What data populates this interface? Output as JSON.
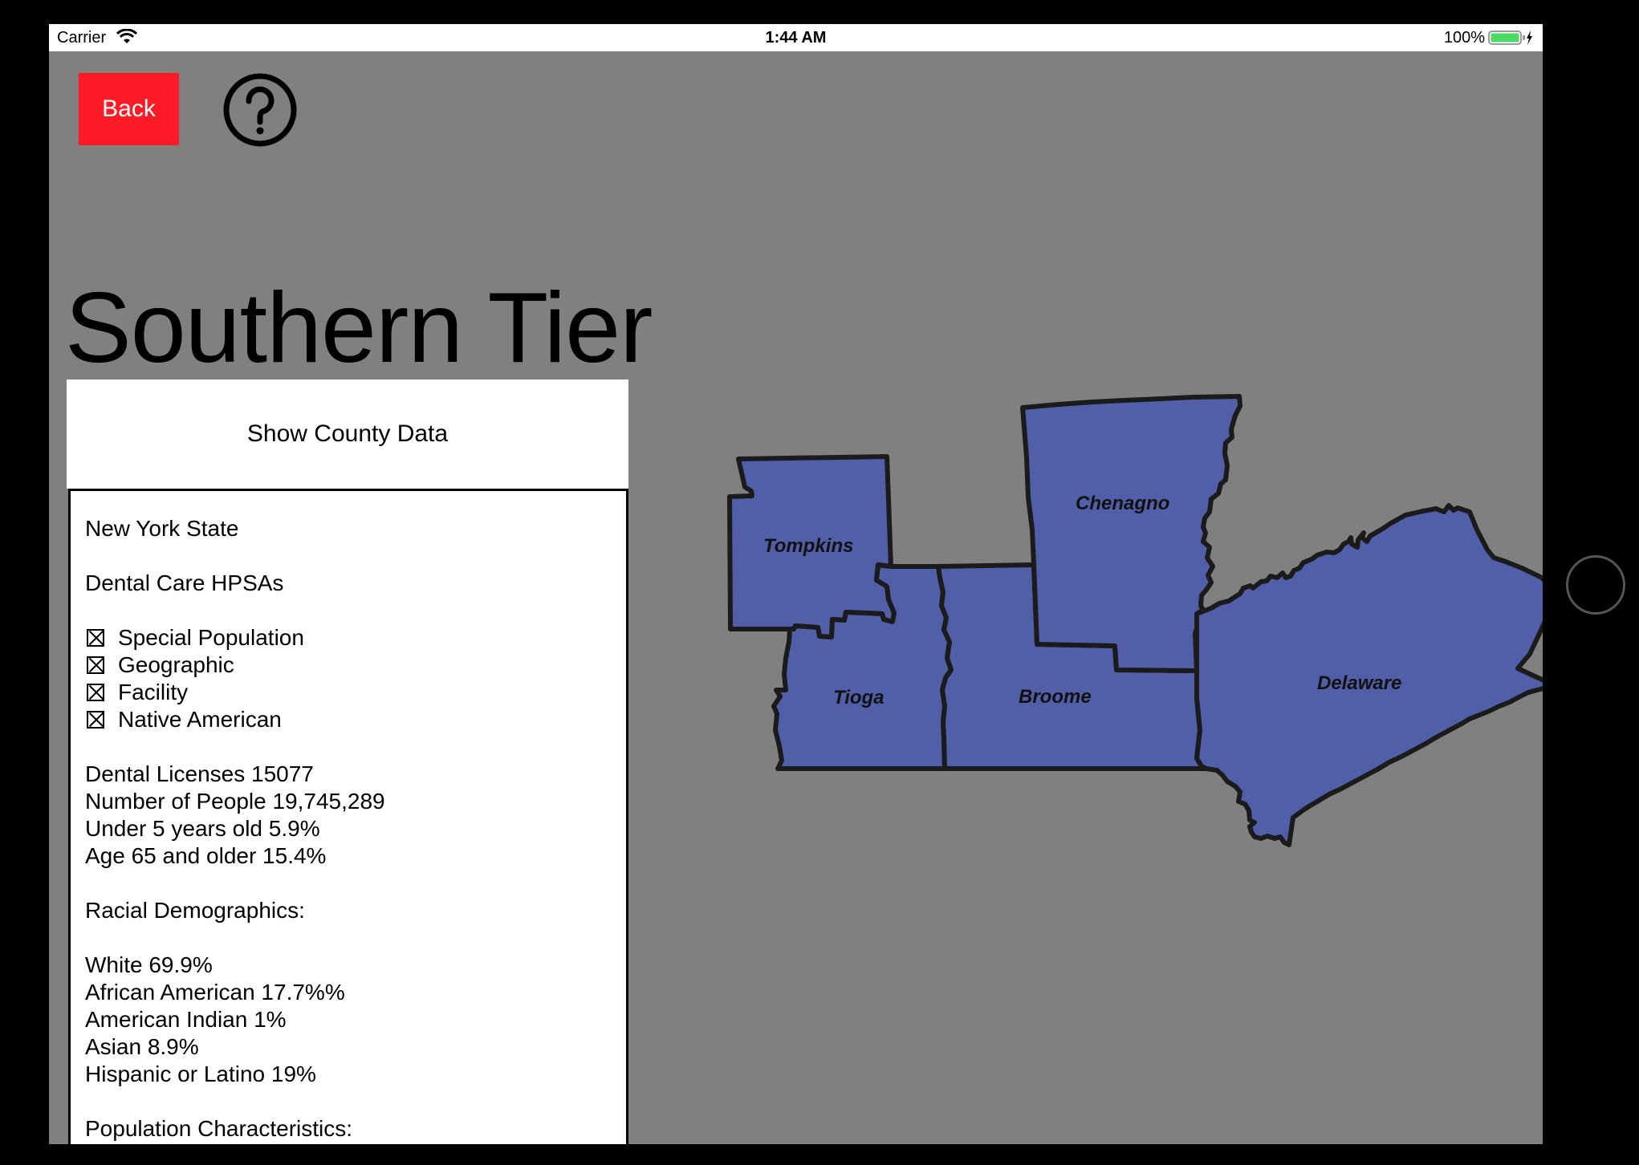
{
  "status_bar": {
    "carrier": "Carrier",
    "time": "1:44 AM",
    "battery": "100%"
  },
  "toolbar": {
    "back_label": "Back",
    "help_icon": "question-circle-icon"
  },
  "page": {
    "title": "Southern Tier"
  },
  "county_button": {
    "label": "Show County Data"
  },
  "info_panel": {
    "region": "New York State",
    "hpsa_heading": "Dental Care HPSAs",
    "hpsa_types": [
      "Special Population",
      "Geographic",
      "Facility",
      "Native American"
    ],
    "stats": [
      "Dental Licenses  15077",
      "Number of People  19,745,289",
      "Under 5 years old 5.9%",
      "Age 65 and older  15.4%"
    ],
    "racial_heading": "Racial Demographics:",
    "racial": [
      "White  69.9%",
      "African American  17.7%%",
      "American Indian  1%",
      "Asian  8.9%",
      "Hispanic or Latino  19%"
    ],
    "next_heading": "Population Characteristics:"
  },
  "map": {
    "fill_color": "#515ea8",
    "counties": [
      "Tompkins",
      "Chenagno",
      "Tioga",
      "Broome",
      "Delaware"
    ]
  },
  "colors": {
    "background": "#808080",
    "back_button": "#fb1a26"
  }
}
